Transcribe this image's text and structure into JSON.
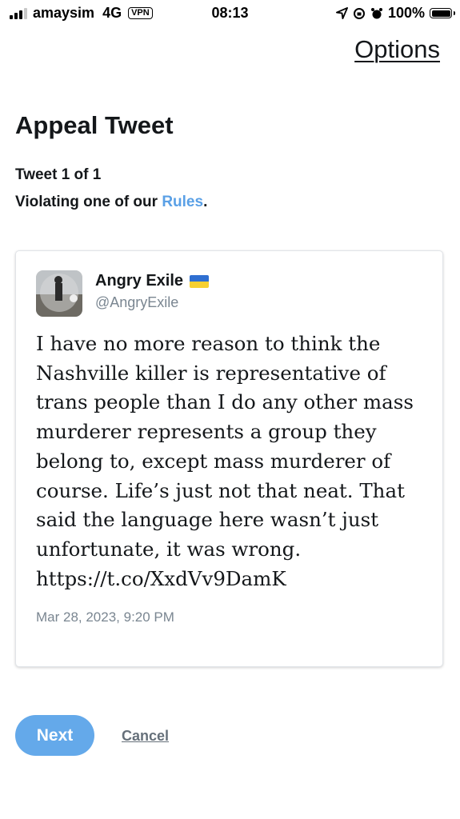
{
  "status_bar": {
    "carrier": "amaysim",
    "network": "4G",
    "vpn": "VPN",
    "time": "08:13",
    "battery": "100%",
    "icons": [
      "signal-icon",
      "location-arrow-icon",
      "orientation-lock-icon",
      "alarm-icon",
      "battery-icon"
    ]
  },
  "header": {
    "options_label": "Options"
  },
  "page": {
    "title": "Appeal Tweet",
    "counter": "Tweet 1 of 1",
    "violation_prefix": "Violating one of our ",
    "violation_link": "Rules",
    "violation_suffix": "."
  },
  "tweet": {
    "author_name": "Angry Exile",
    "author_flag": "ukraine-flag",
    "handle": "@AngryExile",
    "text": "I have no more reason to think the\nNashville killer is representative of\ntrans people than I do any other mass\nmurderer represents a group they\nbelong to, except mass murderer of\ncourse. Life’s just not that neat. That\nsaid the language here wasn’t just\nunfortunate, it was wrong.\nhttps://t.co/XxdVv9DamK",
    "timestamp": "Mar 28, 2023, 9:20 PM"
  },
  "actions": {
    "next_label": "Next",
    "cancel_label": "Cancel"
  },
  "colors": {
    "accent": "#64a9ea",
    "link": "#5aa0e6",
    "muted": "#7a8691"
  }
}
